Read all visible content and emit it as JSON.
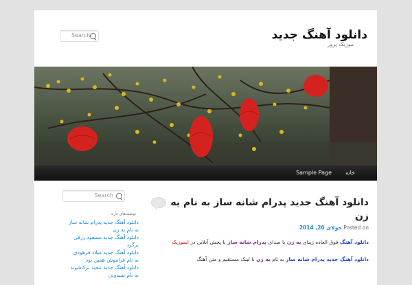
{
  "header": {
    "site_title": "دانلود آهنگ جدید",
    "site_description": "موزیک پرور",
    "search_placeholder": "Search"
  },
  "nav": {
    "items": [
      {
        "label": "خانه"
      },
      {
        "label": "Sample Page"
      }
    ]
  },
  "sidebar": {
    "search_placeholder": "Search",
    "heading": "نوشته‌های تازه",
    "recent_posts": [
      "دانلود آهنگ جدید پدرام شانه ساز",
      "به نام یه زن",
      "دانلود آهنگ جدید مسعود رزقی",
      "برگرد",
      "دانلود آهنگ جدید میلاد فرهودی",
      "به نام فراموش همین بود",
      "دانلود آهنگ جدید مجید ترکاشوند",
      "به نام نمیدونی"
    ]
  },
  "post": {
    "title": "دانلود آهنگ جدید پدرام شانه ساز به نام یه زن",
    "meta_prefix": "Posted on",
    "date": "جولای 20, 2014",
    "p1_part1": "دانلود آهنگ",
    "p1_part2": " فوق العاده زیبای ",
    "p1_part3": "یه زن",
    "p1_part4": " با صدای ",
    "p1_part5": "پدرام شانه ساز",
    "p1_part6": " با پخش آنلاین در ",
    "p1_part7": "ایموزیک",
    "p2_part1": "دانلود آهنگ جدید پدرام شانه ساز",
    "p2_part2": " به نام ",
    "p2_part3": "یه زن",
    "p2_part4": " با لینک مستقیم و متن آهنگ"
  },
  "colors": {
    "link": "#1b8be0",
    "nav_bg": "#1a1a1a",
    "page_bg": "#e2e2e2"
  }
}
